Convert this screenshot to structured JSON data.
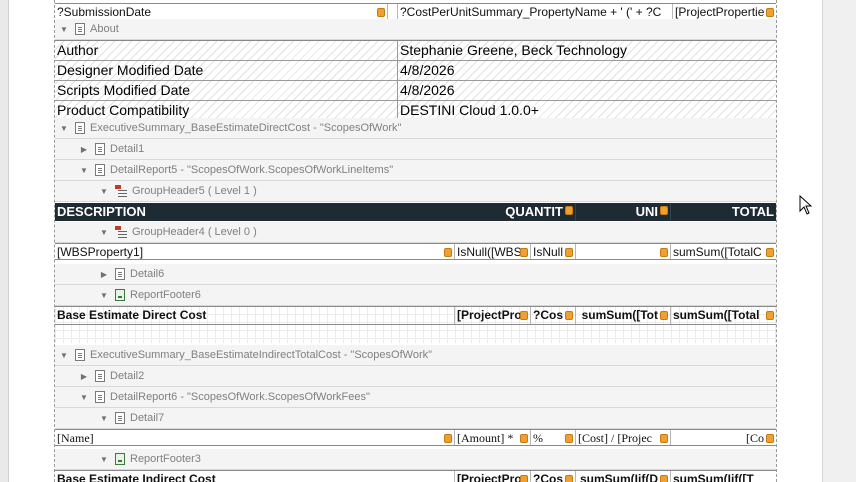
{
  "top_row": {
    "cell1": "?SubmissionDate",
    "cell2": "?CostPerUnitSummary_PropertyName + ' (' + ?C",
    "cell3": "[ProjectPropertie"
  },
  "bands": {
    "about": "About",
    "exec_direct": "ExecutiveSummary_BaseEstimateDirectCost - \"ScopesOfWork\"",
    "detail1": "Detail1",
    "detailreport5": "DetailReport5 - \"ScopesOfWork.ScopesOfWorkLineItems\"",
    "groupheader5": "GroupHeader5 ( Level 1 )",
    "groupheader4": "GroupHeader4 ( Level 0 )",
    "detail6": "Detail6",
    "reportfooter6": "ReportFooter6",
    "exec_indirect": "ExecutiveSummary_BaseEstimateIndirectTotalCost - \"ScopesOfWork\"",
    "detail2": "Detail2",
    "detailreport6": "DetailReport6 - \"ScopesOfWork.ScopesOfWorkFees\"",
    "detail7": "Detail7",
    "reportfooter3": "ReportFooter3"
  },
  "about_table": [
    {
      "key": "Author",
      "value": "Stephanie Greene, Beck Technology"
    },
    {
      "key": "Designer Modified Date",
      "value": "4/8/2026"
    },
    {
      "key": "Scripts Modified Date",
      "value": "4/8/2026"
    },
    {
      "key": "Product Compatibility",
      "value": "DESTINI Cloud 1.0.0+"
    }
  ],
  "column_header": {
    "description": "DESCRIPTION",
    "quantity": "QUANTIT",
    "unit": "UNI",
    "total": "TOTAL"
  },
  "wbs_row": {
    "c1": "[WBSProperty1]",
    "c2": "IsNull([WBS",
    "c3": "IsNull",
    "c4": "",
    "c5": "sumSum([TotalC"
  },
  "direct_footer_row": {
    "c1": "Base Estimate Direct Cost",
    "c2": "[ProjectPro",
    "c3": "?Cos",
    "c4": "sumSum([Tot",
    "c5": "sumSum([Total"
  },
  "fees_row": {
    "c1": "[Name]",
    "c2": "[Amount] *",
    "c3": "%",
    "c4": "[Cost] / [Projec",
    "c5": "[Co"
  },
  "indirect_footer_row": {
    "c1": "Base Estimate Indirect Cost",
    "c2": "[ProjectPro",
    "c3": "?Cos",
    "c4": "sumSum(Iif(D",
    "c5": "sumSum(Iif([T"
  }
}
